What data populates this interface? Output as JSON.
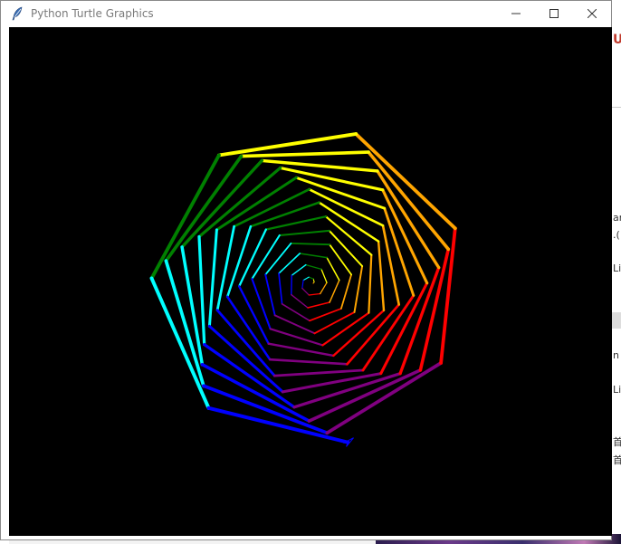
{
  "window": {
    "title": "Python Turtle Graphics",
    "icon": "feather-icon",
    "controls": [
      "minimize-icon",
      "maximize-icon",
      "close-icon"
    ]
  },
  "canvas": {
    "background": "#000000",
    "pattern": "heptagon-spiral",
    "sides": 7,
    "palette": [
      "#ff0000",
      "#ffa500",
      "#ffff00",
      "#008000",
      "#00ffff",
      "#0000ff",
      "#800080"
    ]
  },
  "background_app": {
    "glyphs": [
      "Ur",
      "ar",
      ".(",
      "Li",
      "n",
      "Li",
      "首",
      "首"
    ]
  }
}
